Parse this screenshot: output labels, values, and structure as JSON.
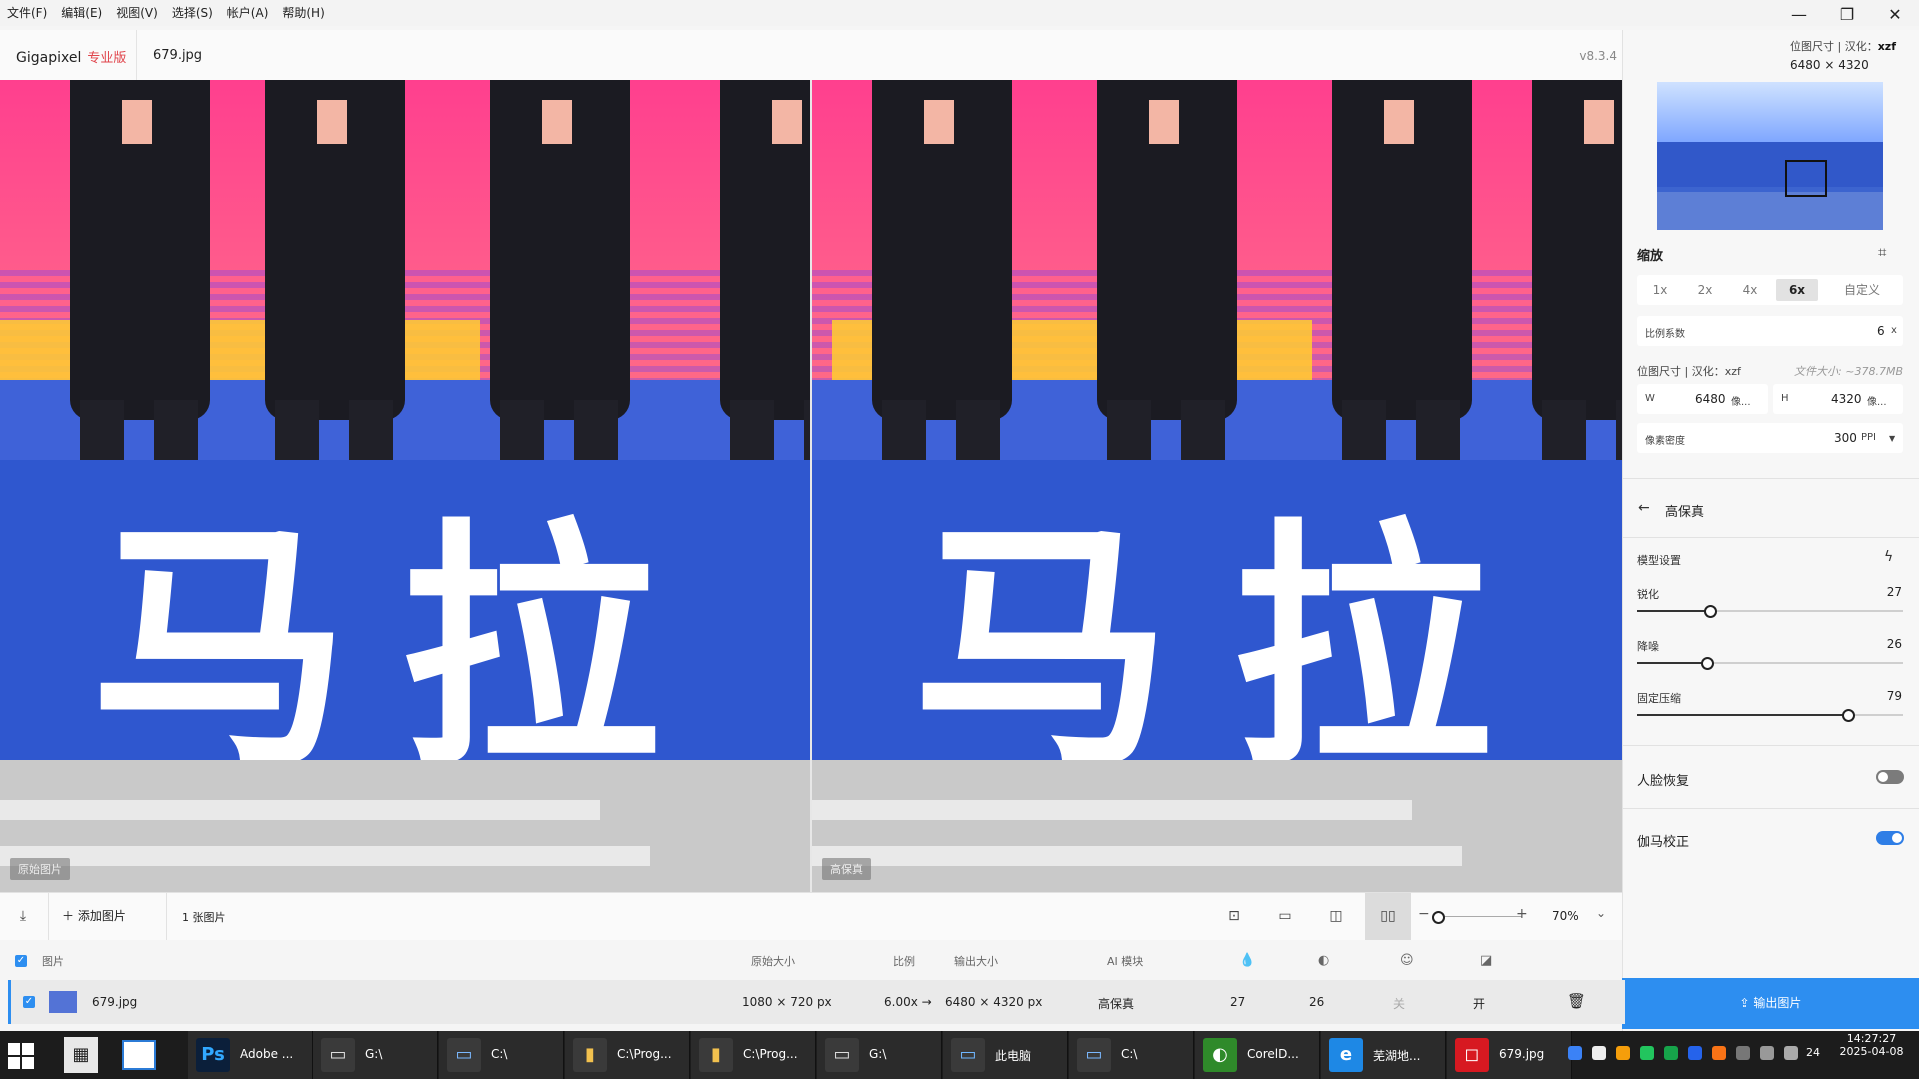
{
  "menu": [
    "文件(F)",
    "编辑(E)",
    "视图(V)",
    "选择(S)",
    "帐户(A)",
    "帮助(H)"
  ],
  "window_controls": {
    "minimize": "—",
    "restore": "❐",
    "close": "✕"
  },
  "app": {
    "brand": "Gigapixel",
    "edition": "专业版",
    "filename": "679.jpg",
    "version": "v8.3.4"
  },
  "preview": {
    "left_label": "原始图片",
    "right_label": "高保真",
    "left_chars": [
      "马",
      "拉"
    ],
    "right_chars": [
      "马",
      "拉"
    ]
  },
  "panel": {
    "dims_head_prefix": "位图尺寸 | 汉化：",
    "dims_head_author": "xzf",
    "dims_value": "6480 × 4320",
    "scale_title": "缩放",
    "scale_options": [
      "1x",
      "2x",
      "4x",
      "6x",
      "自定义"
    ],
    "scale_active": "6x",
    "scale_factor_label": "比例系数",
    "scale_factor_value": "6",
    "scale_factor_unit": "x",
    "size_head": "位图尺寸 | 汉化：xzf",
    "file_size": "文件大小: ~378.7MB",
    "w_label": "W",
    "w_value": "6480",
    "w_unit": "像...",
    "h_label": "H",
    "h_value": "4320",
    "h_unit": "像...",
    "density_label": "像素密度",
    "density_value": "300",
    "density_unit": "PPI",
    "model_name": "高保真",
    "model_settings": "模型设置",
    "sliders": [
      {
        "label": "锐化",
        "value": 27,
        "max": 100
      },
      {
        "label": "降噪",
        "value": 26,
        "max": 100
      },
      {
        "label": "固定压缩",
        "value": 79,
        "max": 100
      }
    ],
    "face_recovery": {
      "label": "人脸恢复",
      "on": false
    },
    "gamma_correction": {
      "label": "伽马校正",
      "on": true
    },
    "export_label": "输出图片"
  },
  "toolbar": {
    "add_image": "添加图片",
    "image_count": "1 张图片",
    "zoom": "70%",
    "zoom_level": 0.06
  },
  "table": {
    "headers": {
      "image": "图片",
      "orig_size": "原始大小",
      "ratio": "比例",
      "out_size": "输出大小",
      "ai_model": "AI 模块"
    },
    "row": {
      "name": "679.jpg",
      "orig_size": "1080 × 720 px",
      "ratio": "6.00x →",
      "out_size": "6480 × 4320 px",
      "ai_model": "高保真",
      "sharpen": "27",
      "denoise": "26",
      "face": "关",
      "gamma": "开"
    }
  },
  "taskbar": {
    "items": [
      {
        "label": "Adobe ...",
        "icon": "Ps",
        "color": "#0b1f3a",
        "fg": "#31a8ff"
      },
      {
        "label": "G:\\",
        "icon": "▭",
        "color": "#3a3a3a",
        "fg": "#ddd"
      },
      {
        "label": "C:\\",
        "icon": "▭",
        "color": "#3a3a3a",
        "fg": "#7ab8ff"
      },
      {
        "label": "C:\\Prog...",
        "icon": "▮",
        "color": "#3a3a3a",
        "fg": "#f2c14e"
      },
      {
        "label": "C:\\Prog...",
        "icon": "▮",
        "color": "#3a3a3a",
        "fg": "#f2c14e"
      },
      {
        "label": "G:\\",
        "icon": "▭",
        "color": "#3a3a3a",
        "fg": "#ddd"
      },
      {
        "label": "此电脑",
        "icon": "▭",
        "color": "#3a3a3a",
        "fg": "#6fb6ff"
      },
      {
        "label": "C:\\",
        "icon": "▭",
        "color": "#3a3a3a",
        "fg": "#7ab8ff"
      },
      {
        "label": "CorelD...",
        "icon": "◐",
        "color": "#2f8a2a",
        "fg": "#fff"
      },
      {
        "label": "芜湖地...",
        "icon": "e",
        "color": "#1e88e5",
        "fg": "#fff"
      },
      {
        "label": "679.jpg",
        "icon": "◻",
        "color": "#d71921",
        "fg": "#fff"
      }
    ],
    "time": "14:27:27",
    "date": "2025-04-08",
    "tray_text": "24"
  }
}
